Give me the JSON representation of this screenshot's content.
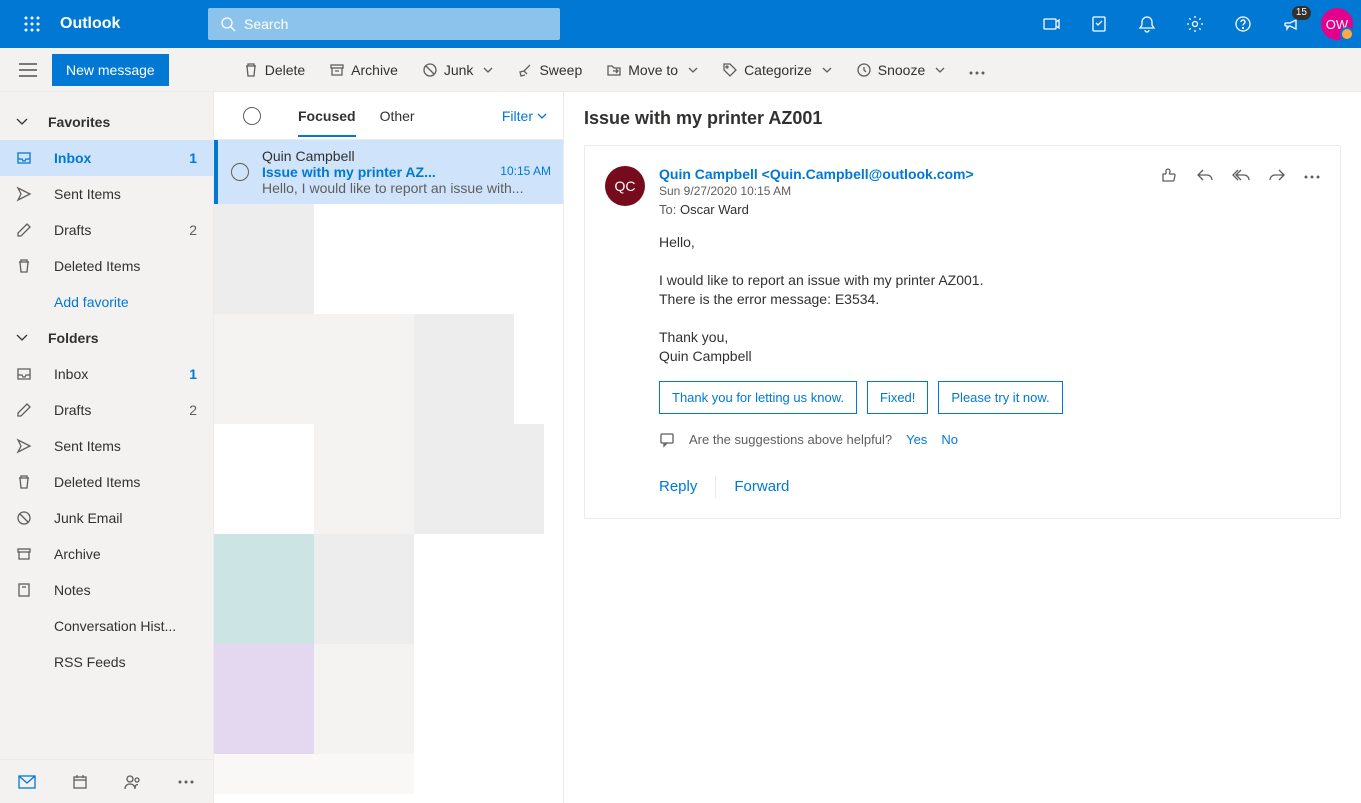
{
  "brand": "Outlook",
  "search": {
    "placeholder": "Search"
  },
  "avatar_initials": "OW",
  "notification_badge": "15",
  "toolbar": {
    "new_message": "New message",
    "delete": "Delete",
    "archive": "Archive",
    "junk": "Junk",
    "sweep": "Sweep",
    "move_to": "Move to",
    "categorize": "Categorize",
    "snooze": "Snooze"
  },
  "sidebar": {
    "favorites_label": "Favorites",
    "folders_label": "Folders",
    "add_favorite": "Add favorite",
    "fav": [
      {
        "label": "Inbox",
        "count": "1"
      },
      {
        "label": "Sent Items",
        "count": ""
      },
      {
        "label": "Drafts",
        "count": "2"
      },
      {
        "label": "Deleted Items",
        "count": ""
      }
    ],
    "folders": [
      {
        "label": "Inbox",
        "count": "1"
      },
      {
        "label": "Drafts",
        "count": "2"
      },
      {
        "label": "Sent Items",
        "count": ""
      },
      {
        "label": "Deleted Items",
        "count": ""
      },
      {
        "label": "Junk Email",
        "count": ""
      },
      {
        "label": "Archive",
        "count": ""
      },
      {
        "label": "Notes",
        "count": ""
      },
      {
        "label": "Conversation Hist...",
        "count": ""
      },
      {
        "label": "RSS Feeds",
        "count": ""
      }
    ]
  },
  "list": {
    "tab_focused": "Focused",
    "tab_other": "Other",
    "filter": "Filter",
    "message": {
      "sender": "Quin Campbell",
      "subject": "Issue with my printer AZ...",
      "time": "10:15 AM",
      "preview": "Hello, I would like to report an issue with..."
    }
  },
  "reading": {
    "subject": "Issue with my printer AZ001",
    "avatar": "QC",
    "from": "Quin Campbell <Quin.Campbell@outlook.com>",
    "date": "Sun 9/27/2020 10:15 AM",
    "to_label": "To:",
    "to": "Oscar Ward",
    "body_p1": "Hello,",
    "body_p2a": "I would like to report an issue with my printer AZ001.",
    "body_p2b": "There is the error message: E3534.",
    "body_p3a": "Thank you,",
    "body_p3b": "Quin Campbell",
    "sugg": [
      "Thank you for letting us know.",
      "Fixed!",
      "Please try it now."
    ],
    "feedback_q": "Are the suggestions above helpful?",
    "feedback_yes": "Yes",
    "feedback_no": "No",
    "reply": "Reply",
    "forward": "Forward"
  }
}
